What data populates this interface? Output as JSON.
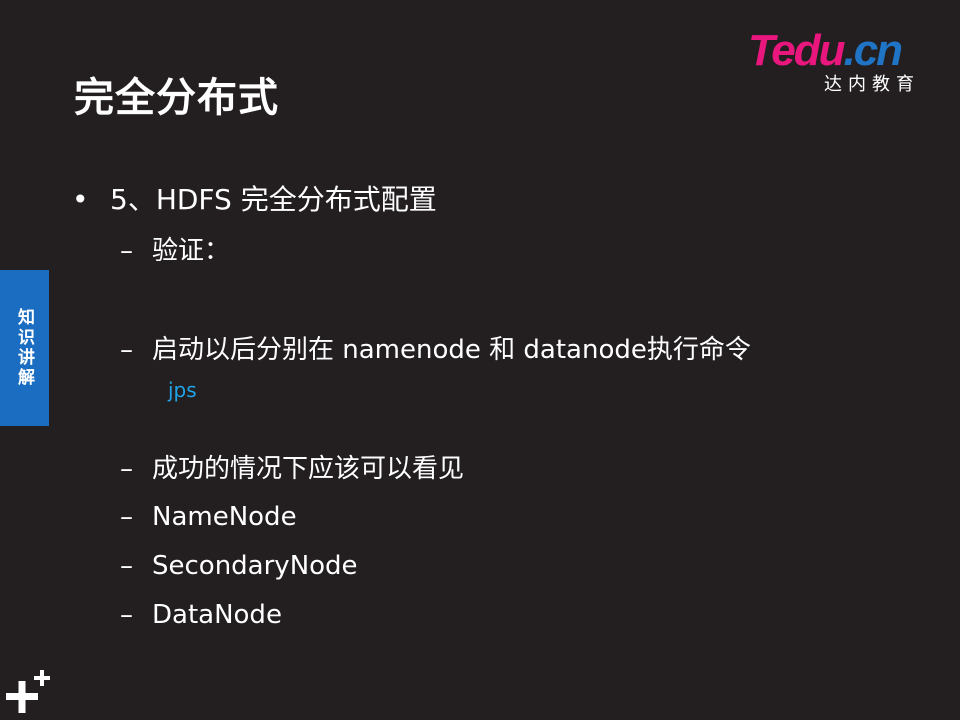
{
  "slide": {
    "title": "完全分布式",
    "logo": {
      "t": "T",
      "edu": "edu",
      "cn": ".cn",
      "sub": "达内教育"
    },
    "side_tab": "知识讲解",
    "bullet": {
      "marker": "•",
      "text": "5、HDFS 完全分布式配置"
    },
    "items": [
      {
        "marker": "–",
        "text": "验证："
      },
      {
        "marker": "–",
        "text": "启动以后分别在 namenode 和 datanode执行命令"
      },
      {
        "marker": "–",
        "text": "成功的情况下应该可以看见"
      },
      {
        "marker": "–",
        "text": "NameNode"
      },
      {
        "marker": "–",
        "text": "SecondaryNode"
      },
      {
        "marker": "–",
        "text": "DataNode"
      }
    ],
    "command": "jps",
    "colors": {
      "background": "#231f20",
      "accent_blue": "#1a6dc0",
      "command_blue": "#1fa3e6",
      "brand_pink": "#e9177d"
    }
  }
}
